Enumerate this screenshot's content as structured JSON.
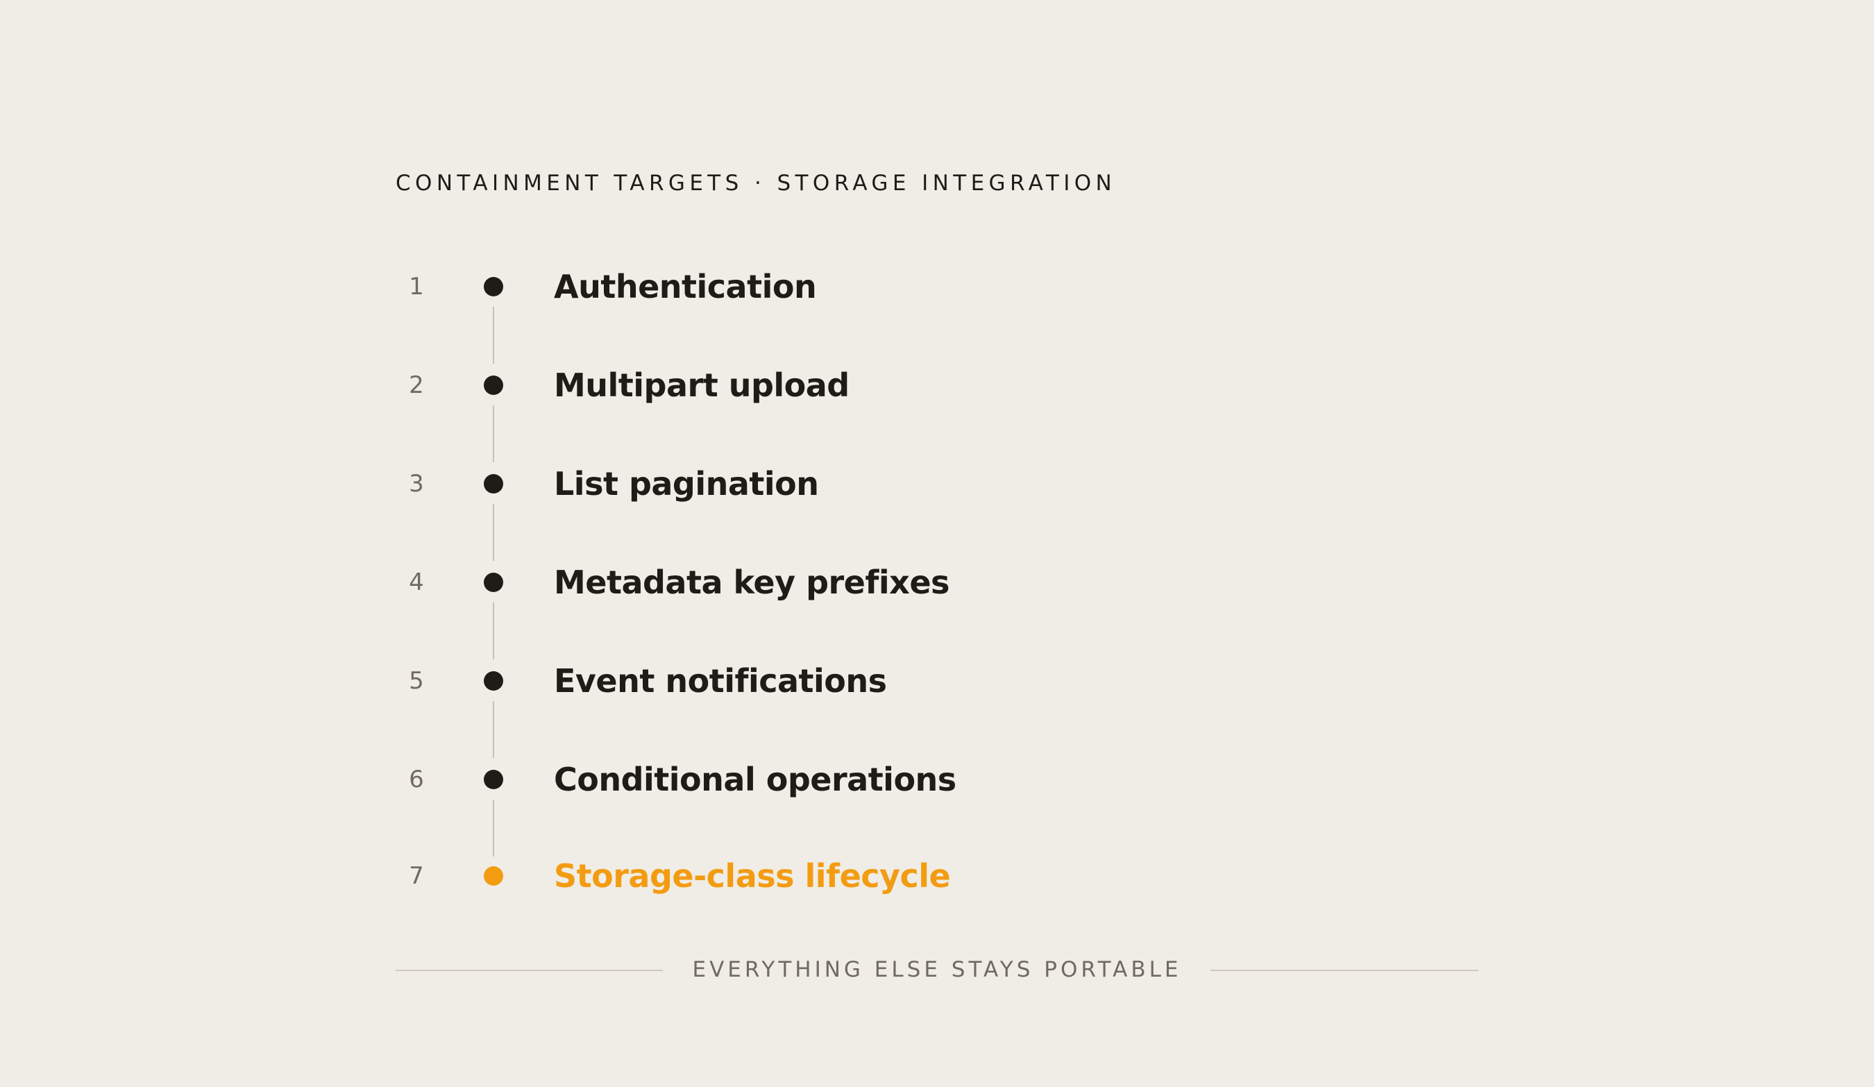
{
  "header": {
    "title": "CONTAINMENT TARGETS · STORAGE INTEGRATION"
  },
  "steps": [
    {
      "number": "1",
      "label": "Authentication",
      "current": false
    },
    {
      "number": "2",
      "label": "Multipart upload",
      "current": false
    },
    {
      "number": "3",
      "label": "List pagination",
      "current": false
    },
    {
      "number": "4",
      "label": "Metadata key prefixes",
      "current": false
    },
    {
      "number": "5",
      "label": "Event notifications",
      "current": false
    },
    {
      "number": "6",
      "label": "Conditional operations",
      "current": false
    },
    {
      "number": "7",
      "label": "Storage-class lifecycle",
      "current": true
    }
  ],
  "footer": {
    "text": "EVERYTHING ELSE STAYS PORTABLE"
  },
  "colors": {
    "background": "#f0ede6",
    "text": "#1f1c18",
    "muted": "#6f6a62",
    "accent": "#f39c12",
    "connector": "#c5c0b8"
  }
}
